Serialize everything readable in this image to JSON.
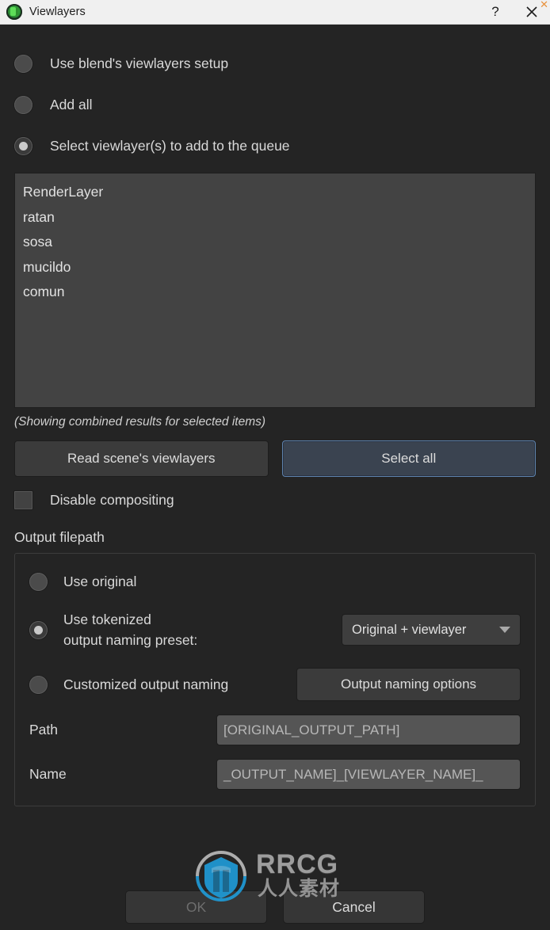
{
  "window": {
    "title": "Viewlayers",
    "icon": "blender-app-icon",
    "help_label": "?",
    "close_label": "✕",
    "corner_mark": "✕"
  },
  "options": {
    "mode_items": [
      {
        "label": "Use blend's viewlayers setup",
        "selected": false
      },
      {
        "label": "Add all",
        "selected": false
      },
      {
        "label": "Select viewlayer(s) to add to the queue",
        "selected": true
      }
    ]
  },
  "viewlayer_list": {
    "items": [
      "RenderLayer",
      "ratan",
      "sosa",
      "mucildo",
      "comun"
    ],
    "note": "(Showing combined results for selected items)"
  },
  "actions": {
    "read_scene_label": "Read scene's viewlayers",
    "select_all_label": "Select all",
    "disable_compositing_label": "Disable compositing",
    "disable_compositing_checked": false
  },
  "output_filepath": {
    "group_title": "Output filepath",
    "naming_items": [
      {
        "label": "Use original",
        "selected": false
      },
      {
        "label": "Use tokenized\noutput naming preset:",
        "selected": true
      },
      {
        "label": "Customized output naming",
        "selected": false
      }
    ],
    "preset_dropdown": {
      "value": "Original + viewlayer",
      "caret": "chevron-down-icon"
    },
    "naming_options_button": "Output naming options",
    "fields": [
      {
        "label": "Path",
        "placeholder": "[ORIGINAL_OUTPUT_PATH]"
      },
      {
        "label": "Name",
        "placeholder": "_OUTPUT_NAME]_[VIEWLAYER_NAME]_"
      }
    ]
  },
  "footer": {
    "ok_label": "OK",
    "cancel_label": "Cancel"
  },
  "watermark": {
    "brand": "RRCG",
    "subtitle": "人人素材"
  },
  "colors": {
    "background": "#242424",
    "titlebar": "#f0f0f0",
    "listbox": "#434343",
    "accent_border": "#5e83ad",
    "accent_fill": "#3a4350",
    "input_fill": "#555555",
    "watermark_blue": "#1f9ad6",
    "corner_orange": "#e8913c"
  }
}
